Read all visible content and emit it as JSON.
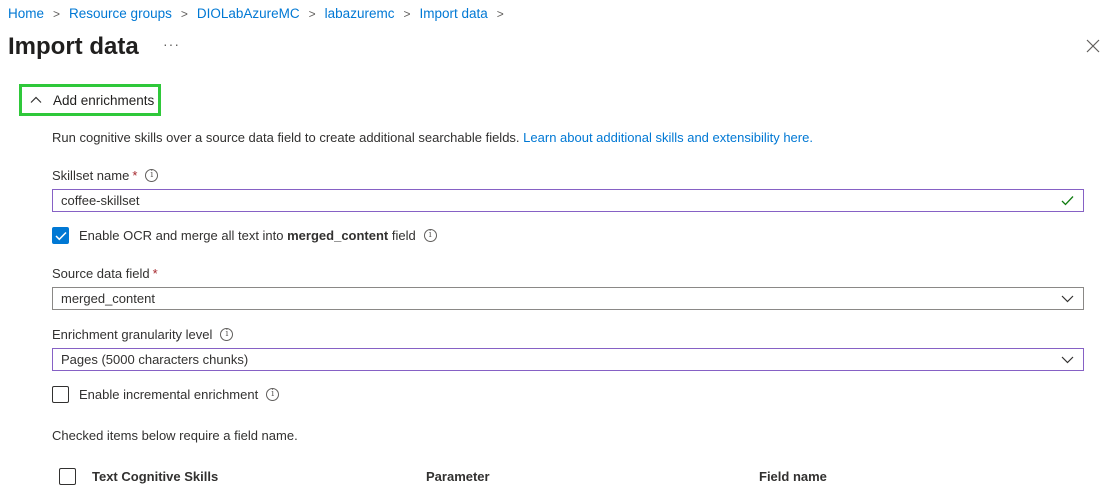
{
  "breadcrumb": {
    "items": [
      "Home",
      "Resource groups",
      "DIOLabAzureMC",
      "labazuremc",
      "Import data"
    ],
    "separator": ">"
  },
  "page": {
    "title": "Import data",
    "more": "···"
  },
  "enrichments": {
    "expander_label": "Add enrichments",
    "description": "Run cognitive skills over a source data field to create additional searchable fields.",
    "learn_link": "Learn about additional skills and extensibility here.",
    "skillset_label": "Skillset name",
    "required_mark": "*",
    "skillset_value": "coffee-skillset",
    "ocr_label_pre": "Enable OCR and merge all text into",
    "ocr_label_bold": "merged_content",
    "ocr_label_post": "field",
    "ocr_checked": true,
    "source_label": "Source data field",
    "source_value": "merged_content",
    "granularity_label": "Enrichment granularity level",
    "granularity_value": "Pages (5000 characters chunks)",
    "incremental_label": "Enable incremental enrichment",
    "incremental_checked": false,
    "note": "Checked items below require a field name.",
    "table_headers": [
      "Text Cognitive Skills",
      "Parameter",
      "Field name"
    ]
  },
  "colors": {
    "accent": "#0078d4",
    "highlight": "#2fc83a",
    "valid": "#107c10",
    "focus_border": "#8661c5"
  },
  "icons": [
    "info-icon",
    "close-icon",
    "chevron-up-icon",
    "chevron-down-icon",
    "checkmark-icon",
    "more-icon"
  ]
}
